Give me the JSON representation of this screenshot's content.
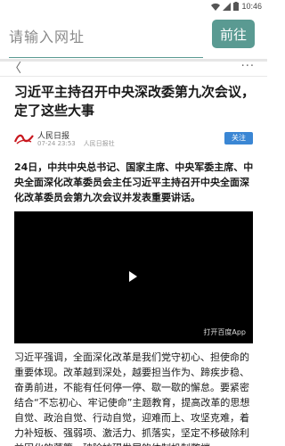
{
  "status_bar": {
    "time": "10:46",
    "icons": [
      "wifi-icon",
      "signal-icon",
      "battery-icon"
    ]
  },
  "url_bar": {
    "placeholder": "请输入网址",
    "go_label": "前往",
    "accent_color": "#5a9a92"
  },
  "nav": {
    "back_icon": "chevron-left-icon",
    "more_icon": "more-icon",
    "back_glyph": "〈",
    "more_glyph": "···"
  },
  "article": {
    "title": "习近平主持召开中央深改委第九次会议，定了这些大事",
    "source": {
      "name": "人民日报",
      "date": "07-24 23:53",
      "account": "人民日报社",
      "follow_label": "关注",
      "logo_icon": "people-daily-logo"
    },
    "lead": "24日，中共中央总书记、国家主席、中央军委主席、中央全面深化改革委员会主任习近平主持召开中央全面深化改革委员会第九次会议并发表重要讲话。",
    "video": {
      "play_icon": "play-icon",
      "open_app_label": "打开百度App"
    },
    "body": "习近平强调，全面深化改革是我们党守初心、担使命的重要体现。改革越到深处，越要担当作为、蹄疾步稳、奋勇前进，不能有任何停一停、歇一歇的懈怠。要紧密结合“不忘初心、牢记使命”主题教育，提高改革的思想自觉、政治自觉、行动自觉，迎难而上、攻坚克难，着力补短板、强弱项、激活力、抓落实，坚定不移破除利益固化的藩篱、破除妨碍发展的体制机制弊端。"
  }
}
